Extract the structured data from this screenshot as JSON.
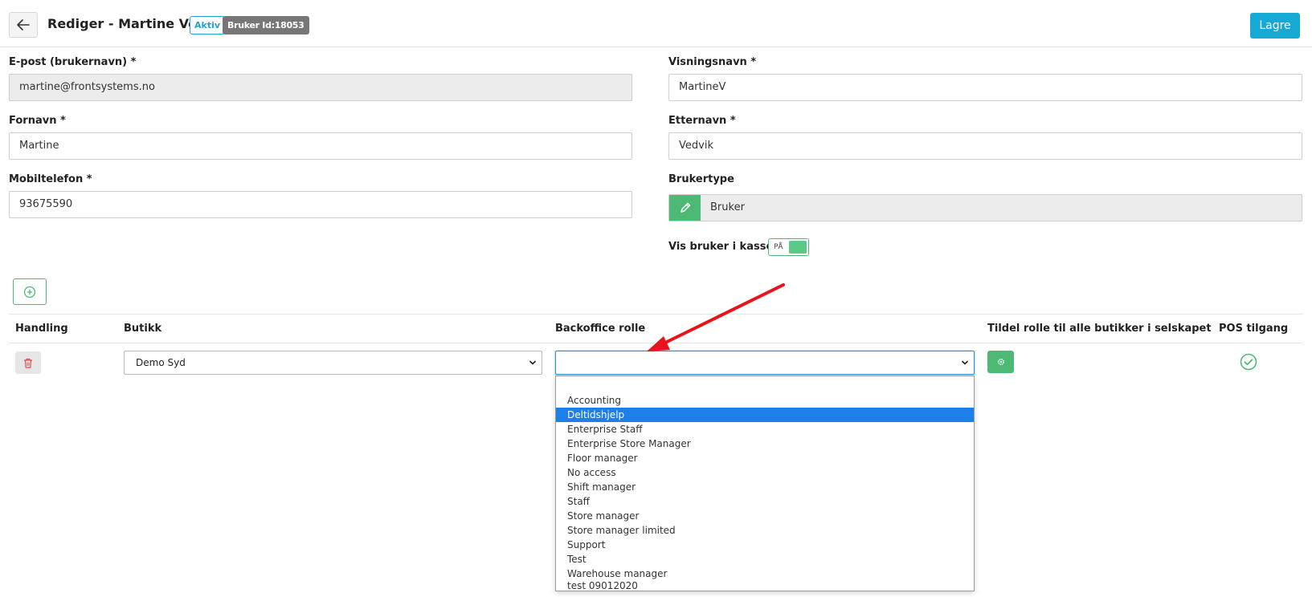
{
  "header": {
    "title": "Rediger - Martine Vedvik",
    "status_badge": "Aktiv",
    "user_id_badge": "Bruker Id:18053",
    "save_label": "Lagre"
  },
  "form": {
    "email": {
      "label": "E-post (brukernavn) *",
      "value": "martine@frontsystems.no"
    },
    "display_name": {
      "label": "Visningsnavn *",
      "value": "MartineV"
    },
    "first_name": {
      "label": "Fornavn *",
      "value": "Martine"
    },
    "last_name": {
      "label": "Etternavn *",
      "value": "Vedvik"
    },
    "mobile": {
      "label": "Mobiltelefon *",
      "value": "93675590"
    },
    "user_type": {
      "label": "Brukertype",
      "value": "Bruker"
    },
    "show_in_pos": {
      "label": "Vis bruker i kassen",
      "toggle_text": "PÅ",
      "on": true
    }
  },
  "table": {
    "headers": [
      "Handling",
      "Butikk",
      "Backoffice rolle",
      "Tildel rolle til alle butikker i selskapet",
      "POS tilgang"
    ],
    "row": {
      "store": "Demo Syd",
      "backoffice_role": "",
      "pos_access": true
    }
  },
  "role_dropdown": {
    "options": [
      "",
      "Accounting",
      "Deltidshjelp",
      "Enterprise Staff",
      "Enterprise Store Manager",
      "Floor manager",
      "No access",
      "Shift manager",
      "Staff",
      "Store manager",
      "Store manager limited",
      "Support",
      "Test",
      "Warehouse manager",
      "test 09012020"
    ],
    "highlighted": "Deltidshjelp"
  },
  "colors": {
    "accent_blue": "#16a9d3",
    "green": "#4cba74",
    "delete_red": "#d9534f",
    "annotation_arrow": "#e8131b",
    "dropdown_highlight": "#1e7fe8"
  },
  "icons": {
    "back": "arrow-left-icon",
    "edit": "pencil-icon",
    "add": "plus-circle-icon",
    "delete": "trash-icon",
    "assign": "gear-icon",
    "pos": "check-circle-icon"
  }
}
